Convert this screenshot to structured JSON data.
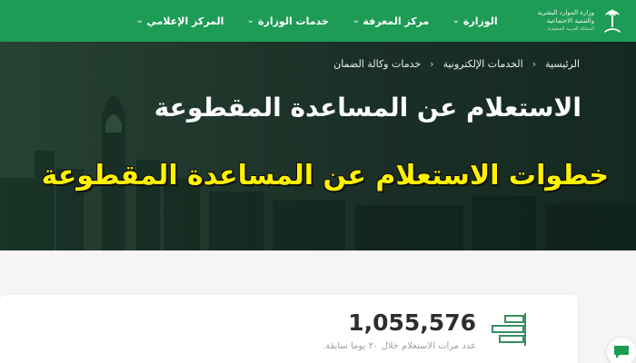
{
  "logo": {
    "line1": "وزارة الموارد البشرية",
    "line2": "والتنمية الاجتماعية",
    "line3": "المملكة العربية السعودية"
  },
  "nav": {
    "items": [
      {
        "label": "الوزارة"
      },
      {
        "label": "مركز المعرفة"
      },
      {
        "label": "خدمات الوزارة"
      },
      {
        "label": "المركز الإعلامي"
      }
    ]
  },
  "breadcrumb": {
    "items": [
      "الرئيسية",
      "الخدمات الإلكترونية",
      "خدمات وكالة الضمان"
    ]
  },
  "page": {
    "title": "الاستعلام عن المساعدة المقطوعة",
    "overlay_title": "خطوات الاستعلام عن المساعدة المقطوعة"
  },
  "stats": {
    "number": "1,055,576",
    "label": "عدد مرات الاستعلام خلال ٣٠ يوما سابقة."
  },
  "colors": {
    "brand": "#1e9b55",
    "overlay_text": "#fff200"
  },
  "icons": {
    "logo": "palm-swords-icon",
    "nav_chevron": "chevron-down-icon",
    "stat": "bar-stats-icon",
    "chat": "chat-icon"
  }
}
